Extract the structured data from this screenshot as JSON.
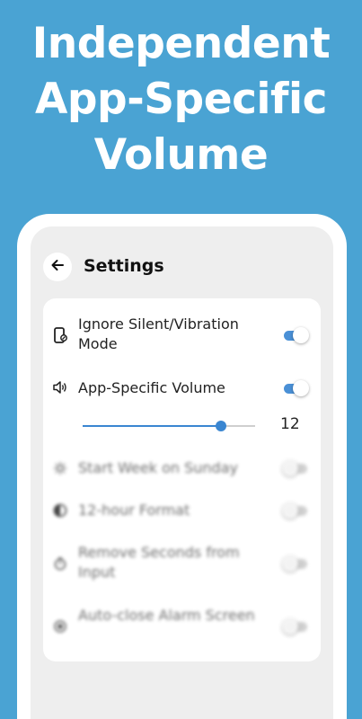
{
  "promo": {
    "line1": "Independent",
    "line2": "App-Specific",
    "line3": "Volume"
  },
  "appbar": {
    "back_icon": "arrow-left-icon",
    "title": "Settings"
  },
  "settings": [
    {
      "icon": "phone-silent-icon",
      "label": "Ignore Silent/Vibration Mode",
      "enabled": true
    },
    {
      "icon": "speaker-icon",
      "label": "App-Specific Volume",
      "enabled": true
    },
    {
      "icon": "sun-icon",
      "label": "Start Week on Sunday",
      "enabled": false
    },
    {
      "icon": "half-circle-icon",
      "label": "12-hour Format",
      "enabled": false
    },
    {
      "icon": "timer-icon",
      "label": "Remove Seconds from Input",
      "enabled": false
    },
    {
      "icon": "radio-dot-icon",
      "label": "Auto-close Alarm Screen",
      "enabled": false
    }
  ],
  "volume_slider": {
    "value": "12",
    "max": 15,
    "fraction": 0.8
  },
  "colors": {
    "background": "#4aa3d3",
    "accent": "#4a90d6"
  }
}
